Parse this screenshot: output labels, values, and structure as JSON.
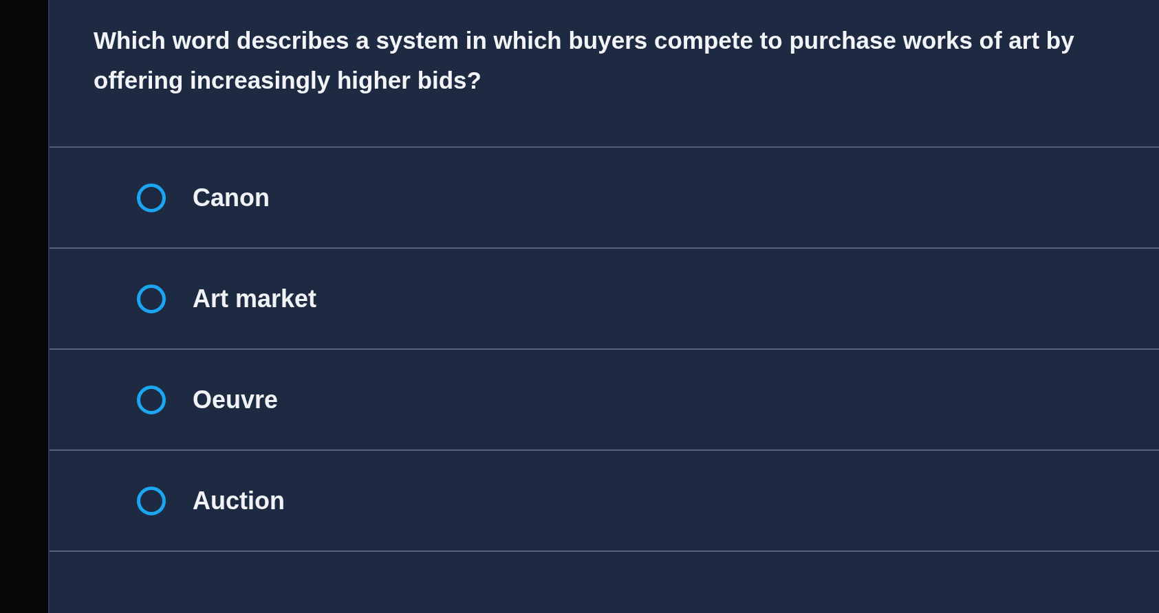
{
  "question": {
    "text": "Which word describes a system in which buyers compete to purchase works of art by offering increasingly higher bids?"
  },
  "options": [
    {
      "label": "Canon",
      "selected": false
    },
    {
      "label": "Art market",
      "selected": false
    },
    {
      "label": "Oeuvre",
      "selected": false
    },
    {
      "label": "Auction",
      "selected": false
    }
  ]
}
